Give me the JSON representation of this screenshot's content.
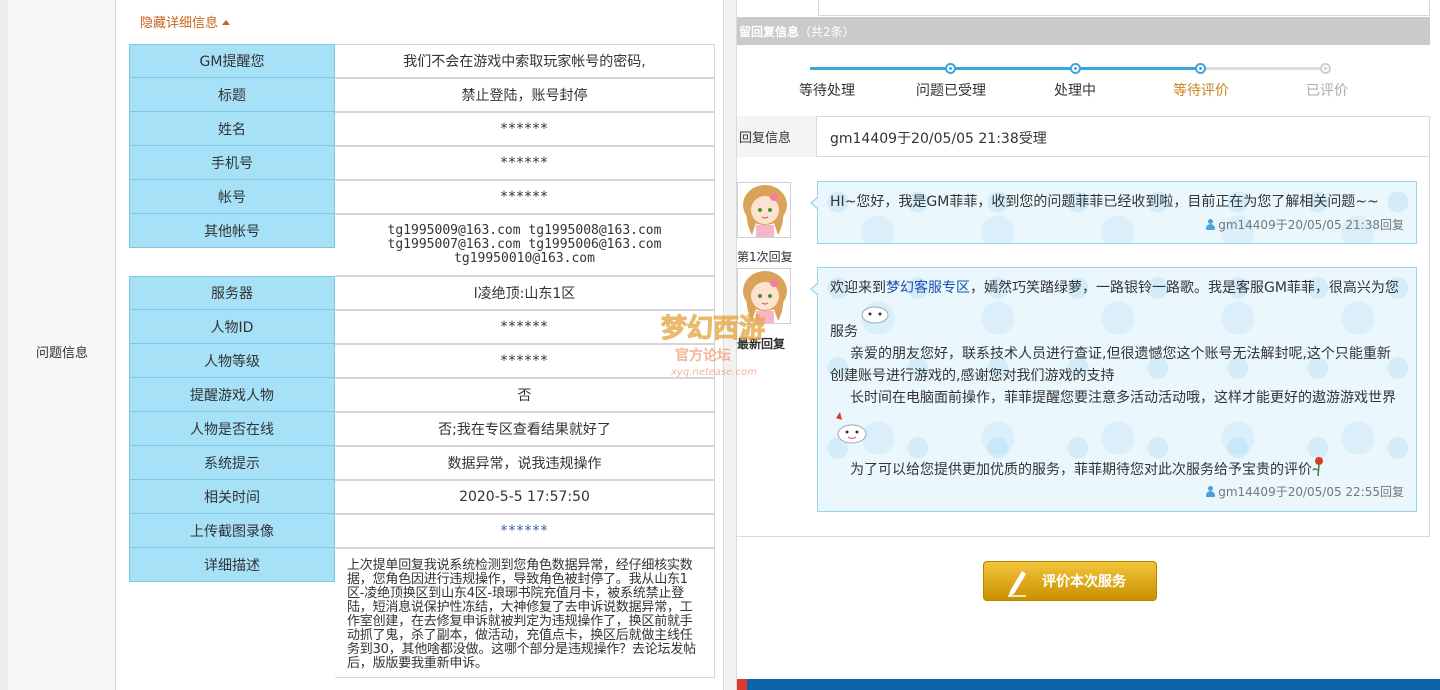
{
  "side_label": "问题信息",
  "toggle_label": "隐藏详细信息",
  "details": {
    "gm_notice_label": "GM提醒您",
    "gm_notice_value": "我们不会在游戏中索取玩家帐号的密码,",
    "title_label": "标题",
    "title_value": "禁止登陆，账号封停",
    "name_label": "姓名",
    "name_value": "******",
    "phone_label": "手机号",
    "phone_value": "******",
    "account_label": "帐号",
    "account_value": "******",
    "other_accounts_label": "其他帐号",
    "other_accounts_lines": [
      "tg1995009@163.com tg1995008@163.com",
      "tg1995007@163.com tg1995006@163.com",
      "tg19950010@163.com"
    ],
    "server_label": "服务器",
    "server_value": "l凌绝顶:山东1区",
    "char_id_label": "人物ID",
    "char_id_value": "******",
    "char_level_label": "人物等级",
    "char_level_value": "******",
    "remind_char_label": "提醒游戏人物",
    "remind_char_value": "否",
    "online_label": "人物是否在线",
    "online_value": "否;我在专区查看结果就好了",
    "sys_hint_label": "系统提示",
    "sys_hint_value": "数据异常，说我违规操作",
    "time_label": "相关时间",
    "time_value": "2020-5-5 17:57:50",
    "screenshot_label": "上传截图录像",
    "screenshot_value": "******",
    "desc_label": "详细描述",
    "desc_value": "上次提单回复我说系统检测到您角色数据异常，经仔细核实数据，您角色因进行违规操作，导致角色被封停了。我从山东1区-凌绝顶换区到山东4区-琅琊书院充值月卡，被系统禁止登陆，短消息说保护性冻结，大神修复了去申诉说数据异常，工作室创建，在去修复申诉就被判定为违规操作了，换区前就手动抓了鬼，杀了副本，做活动，充值点卡，换区后就做主线任务到30，其他啥都没做。这哪个部分是违规操作？去论坛发帖后，版版要我重新申诉。"
  },
  "reply_header_title": "留回复信息",
  "reply_header_count": "（共2条）",
  "steps": [
    "等待处理",
    "问题已受理",
    "处理中",
    "等待评价",
    "已评价"
  ],
  "reply_info_label": "回复信息",
  "reply_info_text": "gm14409于20/05/05 21:38受理",
  "replies": [
    {
      "caption": "第1次回复",
      "text": "HI~您好，我是GM菲菲，收到您的问题菲菲已经收到啦，目前正在为您了解相关问题~~",
      "meta": "gm14409于20/05/05 21:38回复"
    },
    {
      "caption": "最新回复",
      "line1_pre": "欢迎来到",
      "line1_link": "梦幻客服专区",
      "line1_post": "，嫣然巧笑踏绿萝，一路银铃一路歌。我是客服GM菲菲，很高兴为您",
      "line2": "服务",
      "line3": "亲爱的朋友您好，联系技术人员进行查证,但很遗憾您这个账号无法解封呢,这个只能重新",
      "line4": "创建账号进行游戏的,感谢您对我们游戏的支持",
      "line5": "长时间在电脑面前操作，菲菲提醒您要注意多活动活动哦，这样才能更好的遨游游戏世界",
      "line6": "为了可以给您提供更加优质的服务，菲菲期待您对此次服务给予宝贵的评价",
      "meta": "gm14409于20/05/05 22:55回复"
    }
  ],
  "rate_button_label": "评价本次服务",
  "watermark_text": "官方论坛",
  "watermark_url": "xyq.netease.com",
  "colors": {
    "label_bg": "#a6e1f7",
    "accent_orange": "#c8641e",
    "progress_blue": "#3aa6dd",
    "button_gold": "#e0a910"
  }
}
